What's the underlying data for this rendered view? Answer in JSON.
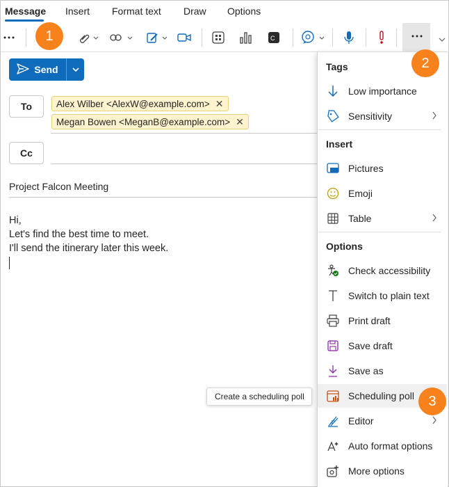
{
  "tabs": [
    "Message",
    "Insert",
    "Format text",
    "Draw",
    "Options"
  ],
  "callouts": [
    "1",
    "2",
    "3"
  ],
  "compose": {
    "send_label": "Send",
    "to_label": "To",
    "cc_label": "Cc",
    "recipients": [
      "Alex Wilber <AlexW@example.com>",
      "Megan Bowen <MeganB@example.com>"
    ],
    "subject": "Project Falcon Meeting",
    "body": [
      "Hi,",
      "Let's find the best time to meet.",
      "I'll send the itinerary later this week."
    ]
  },
  "tooltip": "Create a scheduling poll",
  "menu": {
    "sections": [
      {
        "title": "Tags",
        "items": [
          {
            "label": "Low importance",
            "icon": "arrow-down-icon"
          },
          {
            "label": "Sensitivity",
            "icon": "tag-icon",
            "submenu": true
          }
        ]
      },
      {
        "title": "Insert",
        "items": [
          {
            "label": "Pictures",
            "icon": "picture-icon"
          },
          {
            "label": "Emoji",
            "icon": "emoji-icon"
          },
          {
            "label": "Table",
            "icon": "table-icon",
            "submenu": true
          }
        ]
      },
      {
        "title": "Options",
        "items": [
          {
            "label": "Check accessibility",
            "icon": "accessibility-icon"
          },
          {
            "label": "Switch to plain text",
            "icon": "text-icon"
          },
          {
            "label": "Print draft",
            "icon": "printer-icon"
          },
          {
            "label": "Save draft",
            "icon": "save-icon"
          },
          {
            "label": "Save as",
            "icon": "download-icon"
          },
          {
            "label": "Scheduling poll",
            "icon": "calendar-poll-icon",
            "highlighted": true
          },
          {
            "label": "Editor",
            "icon": "editor-pen-icon",
            "submenu": true
          },
          {
            "label": "Auto format options",
            "icon": "auto-format-icon"
          },
          {
            "label": "More options",
            "icon": "gear-plus-icon"
          }
        ]
      }
    ]
  },
  "colors": {
    "accent": "#0f6cbd",
    "callout": "#f7821b",
    "chip_bg": "#fff4ce",
    "importance_red": "#c50f1f"
  }
}
